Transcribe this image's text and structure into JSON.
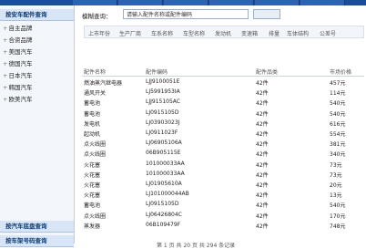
{
  "sidebar": {
    "header_top": "按安车配件查询",
    "items": [
      {
        "label": "自主品牌"
      },
      {
        "label": "合资品牌"
      },
      {
        "label": "美国汽车"
      },
      {
        "label": "德国汽车"
      },
      {
        "label": "日本汽车"
      },
      {
        "label": "韩国汽车"
      },
      {
        "label": "欧美汽车"
      }
    ],
    "header_bottom1": "按汽车底盘查询",
    "header_bottom2": "按车架号码查询"
  },
  "search": {
    "label": "模糊查询：",
    "placeholder": "请输入配件名称或配件编码"
  },
  "filters": [
    "上市年份",
    "生产厂商",
    "车系名称",
    "车型名称",
    "发动机",
    "变速箱",
    "排量",
    "车体结构",
    "公差号"
  ],
  "table": {
    "headers": [
      "配件名称",
      "配件编码",
      "配件品类",
      "市场价格"
    ],
    "rows": [
      [
        "燃油蒸汽继电器",
        "LJJ9100051E",
        "42件",
        "457元"
      ],
      [
        "通风开关",
        "LJ5991953IA",
        "42件",
        "114元"
      ],
      [
        "蓄电池",
        "LJJ915105AC",
        "42件",
        "540元"
      ],
      [
        "蓄电池",
        "LJ0915105D",
        "42件",
        "540元"
      ],
      [
        "发电机",
        "LJ03903023J",
        "42件",
        "616元"
      ],
      [
        "起动机",
        "LJ0911023F",
        "42件",
        "554元"
      ],
      [
        "点火线圈",
        "LJ06905106A",
        "42件",
        "381元"
      ],
      [
        "点火线圈",
        "06B905115E",
        "42件",
        "340元"
      ],
      [
        "火花塞",
        "101000033AA",
        "42件",
        "73元"
      ],
      [
        "火花塞",
        "101000033AA",
        "42件",
        "73元"
      ],
      [
        "火花塞",
        "LJ01905610A",
        "42件",
        "20元"
      ],
      [
        "火花塞",
        "LJ101000044AB",
        "42件",
        "13元"
      ],
      [
        "蓄电池",
        "LJ0915105D",
        "42件",
        "540元"
      ],
      [
        "点火线圈",
        "LJ06426804C",
        "42件",
        "170元"
      ],
      [
        "蒸发器",
        "06B109479F",
        "42件",
        "748元"
      ]
    ]
  },
  "pager": "第 1 页 共 20 页    共 294 条记录"
}
